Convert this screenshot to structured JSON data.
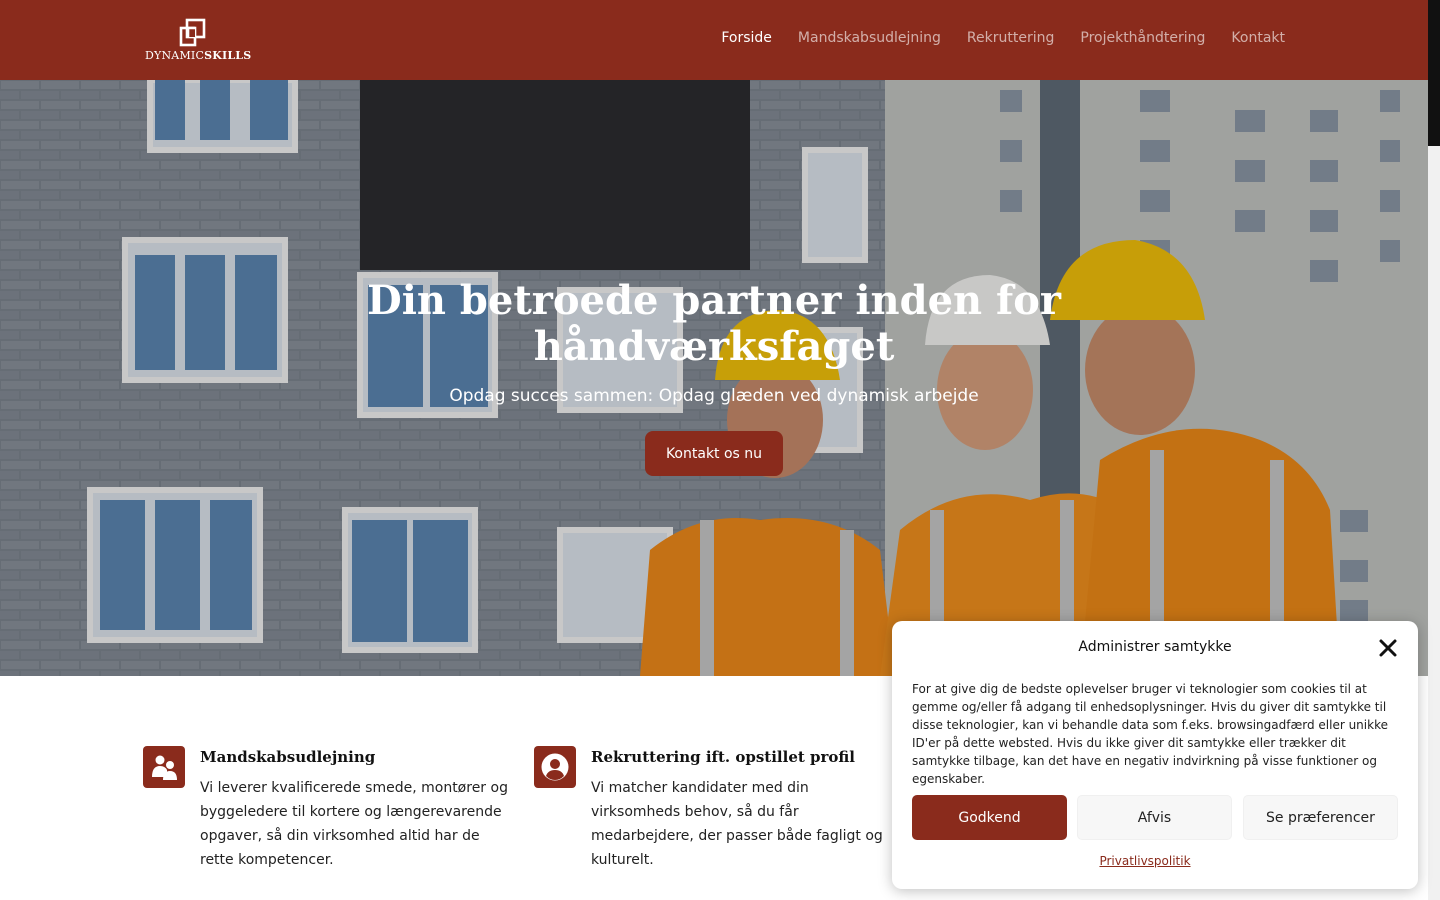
{
  "brand": {
    "logo_prefix": "DYNAMIC",
    "logo_suffix": "SKILLS",
    "primary_color": "#8a2b1c"
  },
  "nav": {
    "items": [
      {
        "label": "Forside",
        "active": true
      },
      {
        "label": "Mandskabsudlejning",
        "active": false
      },
      {
        "label": "Rekruttering",
        "active": false
      },
      {
        "label": "Projekthåndtering",
        "active": false
      },
      {
        "label": "Kontakt",
        "active": false
      }
    ]
  },
  "hero": {
    "title_line1": "Din betroede partner inden for",
    "title_line2": "håndværksfaget",
    "subtitle": "Opdag succes sammen: Opdag glæden ved dynamisk arbejde",
    "cta_label": "Kontakt os nu",
    "image": "construction-workers-hardhats-photo"
  },
  "services": [
    {
      "icon": "users-icon",
      "title": "Mandskabsudlejning",
      "text": "Vi leverer kvalificerede smede, montører og byggeledere til kortere og længerevarende opgaver, så din virksomhed altid har de rette kompetencer."
    },
    {
      "icon": "user-circle-icon",
      "title": "Rekruttering ift. opstillet profil",
      "text": "Vi matcher kandidater med din virksomheds behov, så du får medarbejdere, der passer både fagligt og kulturelt."
    }
  ],
  "cookie": {
    "title": "Administrer samtykke",
    "text": "For at give dig de bedste oplevelser bruger vi teknologier som cookies til at gemme og/eller få adgang til enhedsoplysninger. Hvis du giver dit samtykke til disse teknologier, kan vi behandle data som f.eks. browsingadfærd eller unikke ID'er på dette websted. Hvis du ikke giver dit samtykke eller trækker dit samtykke tilbage, kan det have en negativ indvirkning på visse funktioner og egenskaber.",
    "accept_label": "Godkend",
    "deny_label": "Afvis",
    "prefs_label": "Se præferencer",
    "privacy_label": "Privatlivspolitik"
  }
}
